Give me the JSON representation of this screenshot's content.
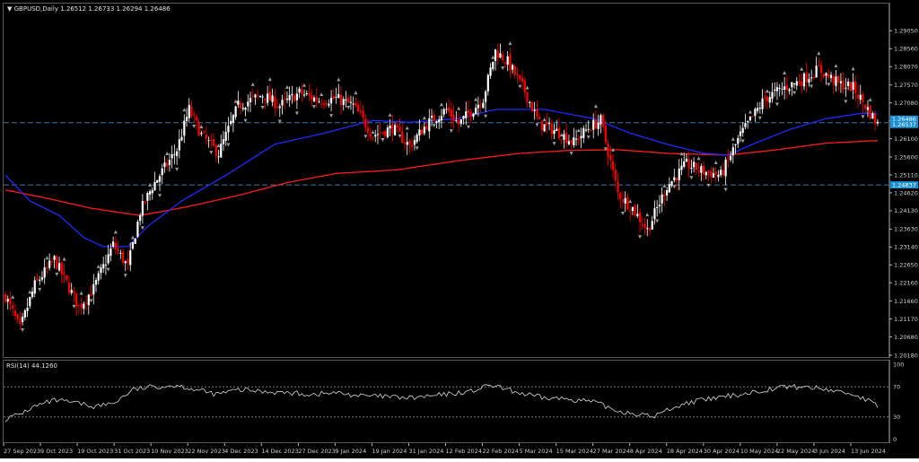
{
  "header": {
    "arrow": "▼",
    "symbol_line": "GBPUSD,Daily  1.26512 1.26733 1.26294 1.26486"
  },
  "rsi": {
    "label": "RSI(14) 44.1260",
    "levels": [
      70,
      30
    ],
    "axis_ticks": [
      "100",
      "70",
      "30",
      "0"
    ]
  },
  "colors": {
    "bull": "#ffffff",
    "bear": "#ff0000",
    "ma_fast": "#1e2aff",
    "ma_slow": "#ff1a1a",
    "hline": "#3a78a8",
    "rsi_line": "#d9d9d9",
    "badge": "#1a8fd1"
  },
  "price_badges": [
    "1.26486",
    "1.26537",
    "1.24837"
  ],
  "chart_data": {
    "type": "candlestick",
    "title": "GBPUSD,Daily",
    "ohlc_header": {
      "open": 1.26512,
      "high": 1.26733,
      "low": 1.26294,
      "close": 1.26486
    },
    "ylim": [
      1.2018,
      1.295
    ],
    "y_ticks": [
      "1.29050",
      "1.28560",
      "1.28070",
      "1.27570",
      "1.27080",
      "1.26590",
      "1.26100",
      "1.25600",
      "1.25110",
      "1.24620",
      "1.24130",
      "1.23630",
      "1.23140",
      "1.22650",
      "1.22160",
      "1.21660",
      "1.21170",
      "1.20680",
      "1.20180"
    ],
    "x_labels": [
      "27 Sep 2023",
      "9 Oct 2023",
      "19 Oct 2023",
      "31 Oct 2023",
      "10 Nov 2023",
      "22 Nov 2023",
      "4 Dec 2023",
      "14 Dec 2023",
      "27 Dec 2023",
      "9 Jan 2024",
      "19 Jan 2024",
      "31 Jan 2024",
      "12 Feb 2024",
      "22 Feb 2024",
      "5 Mar 2024",
      "15 Mar 2024",
      "27 Mar 2024",
      "8 Apr 2024",
      "18 Apr 2024",
      "30 Apr 2024",
      "10 May 2024",
      "22 May 2024",
      "3 Jun 2024",
      "13 Jun 2024"
    ],
    "horizontal_lines": [
      1.26537,
      1.24837
    ],
    "close_anchors": [
      [
        0,
        1.218
      ],
      [
        6,
        1.209
      ],
      [
        12,
        1.221
      ],
      [
        20,
        1.228
      ],
      [
        30,
        1.215
      ],
      [
        36,
        1.22
      ],
      [
        44,
        1.232
      ],
      [
        50,
        1.226
      ],
      [
        55,
        1.241
      ],
      [
        60,
        1.248
      ],
      [
        70,
        1.258
      ],
      [
        75,
        1.269
      ],
      [
        80,
        1.262
      ],
      [
        87,
        1.257
      ],
      [
        95,
        1.27
      ],
      [
        105,
        1.273
      ],
      [
        112,
        1.27
      ],
      [
        120,
        1.2735
      ],
      [
        128,
        1.2715
      ],
      [
        135,
        1.272
      ],
      [
        142,
        1.27
      ],
      [
        150,
        1.262
      ],
      [
        158,
        1.264
      ],
      [
        165,
        1.259
      ],
      [
        172,
        1.265
      ],
      [
        180,
        1.269
      ],
      [
        185,
        1.265
      ],
      [
        195,
        1.272
      ],
      [
        200,
        1.285
      ],
      [
        205,
        1.282
      ],
      [
        212,
        1.274
      ],
      [
        218,
        1.265
      ],
      [
        225,
        1.263
      ],
      [
        232,
        1.26
      ],
      [
        238,
        1.264
      ],
      [
        243,
        1.266
      ],
      [
        250,
        1.246
      ],
      [
        256,
        1.242
      ],
      [
        262,
        1.236
      ],
      [
        270,
        1.248
      ],
      [
        278,
        1.254
      ],
      [
        285,
        1.252
      ],
      [
        292,
        1.251
      ],
      [
        300,
        1.262
      ],
      [
        310,
        1.272
      ],
      [
        318,
        1.275
      ],
      [
        325,
        1.277
      ],
      [
        332,
        1.28
      ],
      [
        340,
        1.276
      ],
      [
        346,
        1.275
      ],
      [
        352,
        1.269
      ],
      [
        356,
        1.2649
      ]
    ],
    "ma_fast_anchors": [
      [
        0,
        1.251
      ],
      [
        10,
        1.244
      ],
      [
        22,
        1.24
      ],
      [
        32,
        1.234
      ],
      [
        40,
        1.2315
      ],
      [
        50,
        1.2315
      ],
      [
        58,
        1.237
      ],
      [
        72,
        1.244
      ],
      [
        90,
        1.251
      ],
      [
        110,
        1.2595
      ],
      [
        130,
        1.2625
      ],
      [
        150,
        1.266
      ],
      [
        165,
        1.2655
      ],
      [
        185,
        1.2665
      ],
      [
        200,
        1.269
      ],
      [
        220,
        1.269
      ],
      [
        240,
        1.2665
      ],
      [
        255,
        1.2625
      ],
      [
        270,
        1.2595
      ],
      [
        285,
        1.257
      ],
      [
        295,
        1.2565
      ],
      [
        305,
        1.2595
      ],
      [
        320,
        1.2635
      ],
      [
        335,
        1.2665
      ],
      [
        350,
        1.268
      ],
      [
        356,
        1.2678
      ]
    ],
    "ma_slow_anchors": [
      [
        0,
        1.247
      ],
      [
        15,
        1.245
      ],
      [
        35,
        1.242
      ],
      [
        55,
        1.24
      ],
      [
        75,
        1.2425
      ],
      [
        95,
        1.2455
      ],
      [
        115,
        1.249
      ],
      [
        135,
        1.2515
      ],
      [
        160,
        1.2525
      ],
      [
        185,
        1.255
      ],
      [
        210,
        1.257
      ],
      [
        230,
        1.2578
      ],
      [
        250,
        1.258
      ],
      [
        270,
        1.257
      ],
      [
        295,
        1.2565
      ],
      [
        315,
        1.258
      ],
      [
        335,
        1.2598
      ],
      [
        356,
        1.2605
      ]
    ],
    "rsi_anchors": [
      [
        0,
        27
      ],
      [
        6,
        34
      ],
      [
        12,
        44
      ],
      [
        20,
        52
      ],
      [
        30,
        48
      ],
      [
        36,
        44
      ],
      [
        44,
        48
      ],
      [
        52,
        66
      ],
      [
        60,
        70
      ],
      [
        70,
        72
      ],
      [
        78,
        66
      ],
      [
        86,
        60
      ],
      [
        95,
        66
      ],
      [
        105,
        64
      ],
      [
        115,
        62
      ],
      [
        125,
        60
      ],
      [
        135,
        62
      ],
      [
        145,
        58
      ],
      [
        155,
        57
      ],
      [
        165,
        55
      ],
      [
        175,
        58
      ],
      [
        190,
        64
      ],
      [
        198,
        72
      ],
      [
        205,
        66
      ],
      [
        212,
        60
      ],
      [
        220,
        55
      ],
      [
        230,
        54
      ],
      [
        240,
        50
      ],
      [
        250,
        38
      ],
      [
        258,
        34
      ],
      [
        264,
        30
      ],
      [
        272,
        42
      ],
      [
        280,
        50
      ],
      [
        290,
        55
      ],
      [
        300,
        60
      ],
      [
        310,
        66
      ],
      [
        318,
        70
      ],
      [
        325,
        70
      ],
      [
        332,
        68
      ],
      [
        340,
        64
      ],
      [
        346,
        60
      ],
      [
        352,
        52
      ],
      [
        356,
        44
      ]
    ],
    "n_bars": 357
  }
}
